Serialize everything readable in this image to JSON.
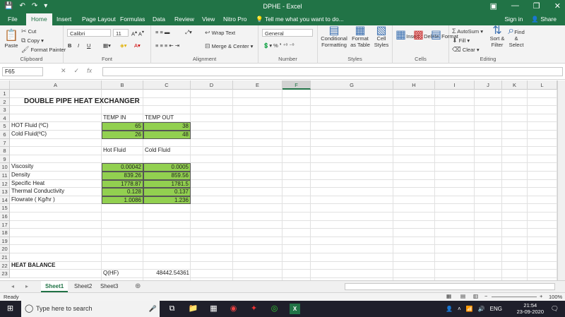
{
  "window": {
    "title": "DPHE - Excel"
  },
  "tabs": [
    "File",
    "Home",
    "Insert",
    "Page Layout",
    "Formulas",
    "Data",
    "Review",
    "View",
    "Nitro Pro"
  ],
  "tell_me": "Tell me what you want to do...",
  "account": {
    "sign_in": "Sign in",
    "share": "Share"
  },
  "ribbon": {
    "clipboard": {
      "label": "Clipboard",
      "paste": "Paste",
      "cut": "Cut",
      "copy": "Copy",
      "format_painter": "Format Painter"
    },
    "font": {
      "label": "Font",
      "name": "Calibri",
      "size": "11"
    },
    "alignment": {
      "label": "Alignment",
      "wrap": "Wrap Text",
      "merge": "Merge & Center"
    },
    "number": {
      "label": "Number",
      "format": "General"
    },
    "styles": {
      "label": "Styles",
      "cond": "Conditional Formatting",
      "table": "Format as Table",
      "cell": "Cell Styles"
    },
    "cells": {
      "label": "Cells",
      "insert": "Insert",
      "delete": "Delete",
      "format": "Format"
    },
    "editing": {
      "label": "Editing",
      "autosum": "AutoSum",
      "fill": "Fill",
      "clear": "Clear",
      "sort": "Sort & Filter",
      "find": "Find & Select"
    }
  },
  "formula_bar": {
    "name_box": "F65",
    "fx": "fx",
    "value": ""
  },
  "columns": [
    "A",
    "B",
    "C",
    "D",
    "E",
    "F",
    "G",
    "H",
    "I",
    "J",
    "K",
    "L"
  ],
  "rows": [
    "1",
    "2",
    "3",
    "4",
    "5",
    "6",
    "7",
    "8",
    "9",
    "10",
    "11",
    "12",
    "13",
    "14",
    "15",
    "16",
    "17",
    "18",
    "19",
    "20",
    "21",
    "22",
    "23"
  ],
  "cells": {
    "A2": "DOUBLE PIPE HEAT EXCHANGER",
    "B4": "TEMP IN",
    "C4": "TEMP OUT",
    "A5": "HOT Fluid (ºC)",
    "B5": "65",
    "C5": "38",
    "A6": "Cold Fluid(ºC)",
    "B6": "26",
    "C6": "48",
    "B8": "Hot Fluid",
    "C8": "Cold Fluid",
    "A10": "Viscosity",
    "B10": "0.00042",
    "C10": "0.0005",
    "A11": "Density",
    "B11": "839.26",
    "C11": "859.56",
    "A12": "Specific Heat",
    "B12": "1778.87",
    "C12": "1781.5",
    "A13": "Thermal Conductivity",
    "B13": "0.128",
    "C13": "0.137",
    "A14": "Flowrate ( Kg/hr )",
    "B14": "1.0086",
    "C14": "1.236",
    "A22": "HEAT BALANCE",
    "B23": "Q(HF)",
    "C23": "48442.54361"
  },
  "sheets": [
    "Sheet1",
    "Sheet2",
    "Sheet3"
  ],
  "status": {
    "ready": "Ready",
    "zoom": "100%"
  },
  "taskbar": {
    "search": "Type here to search",
    "lang": "ENG",
    "time": "21:54",
    "date": "23-09-2020",
    "notif": "2"
  }
}
